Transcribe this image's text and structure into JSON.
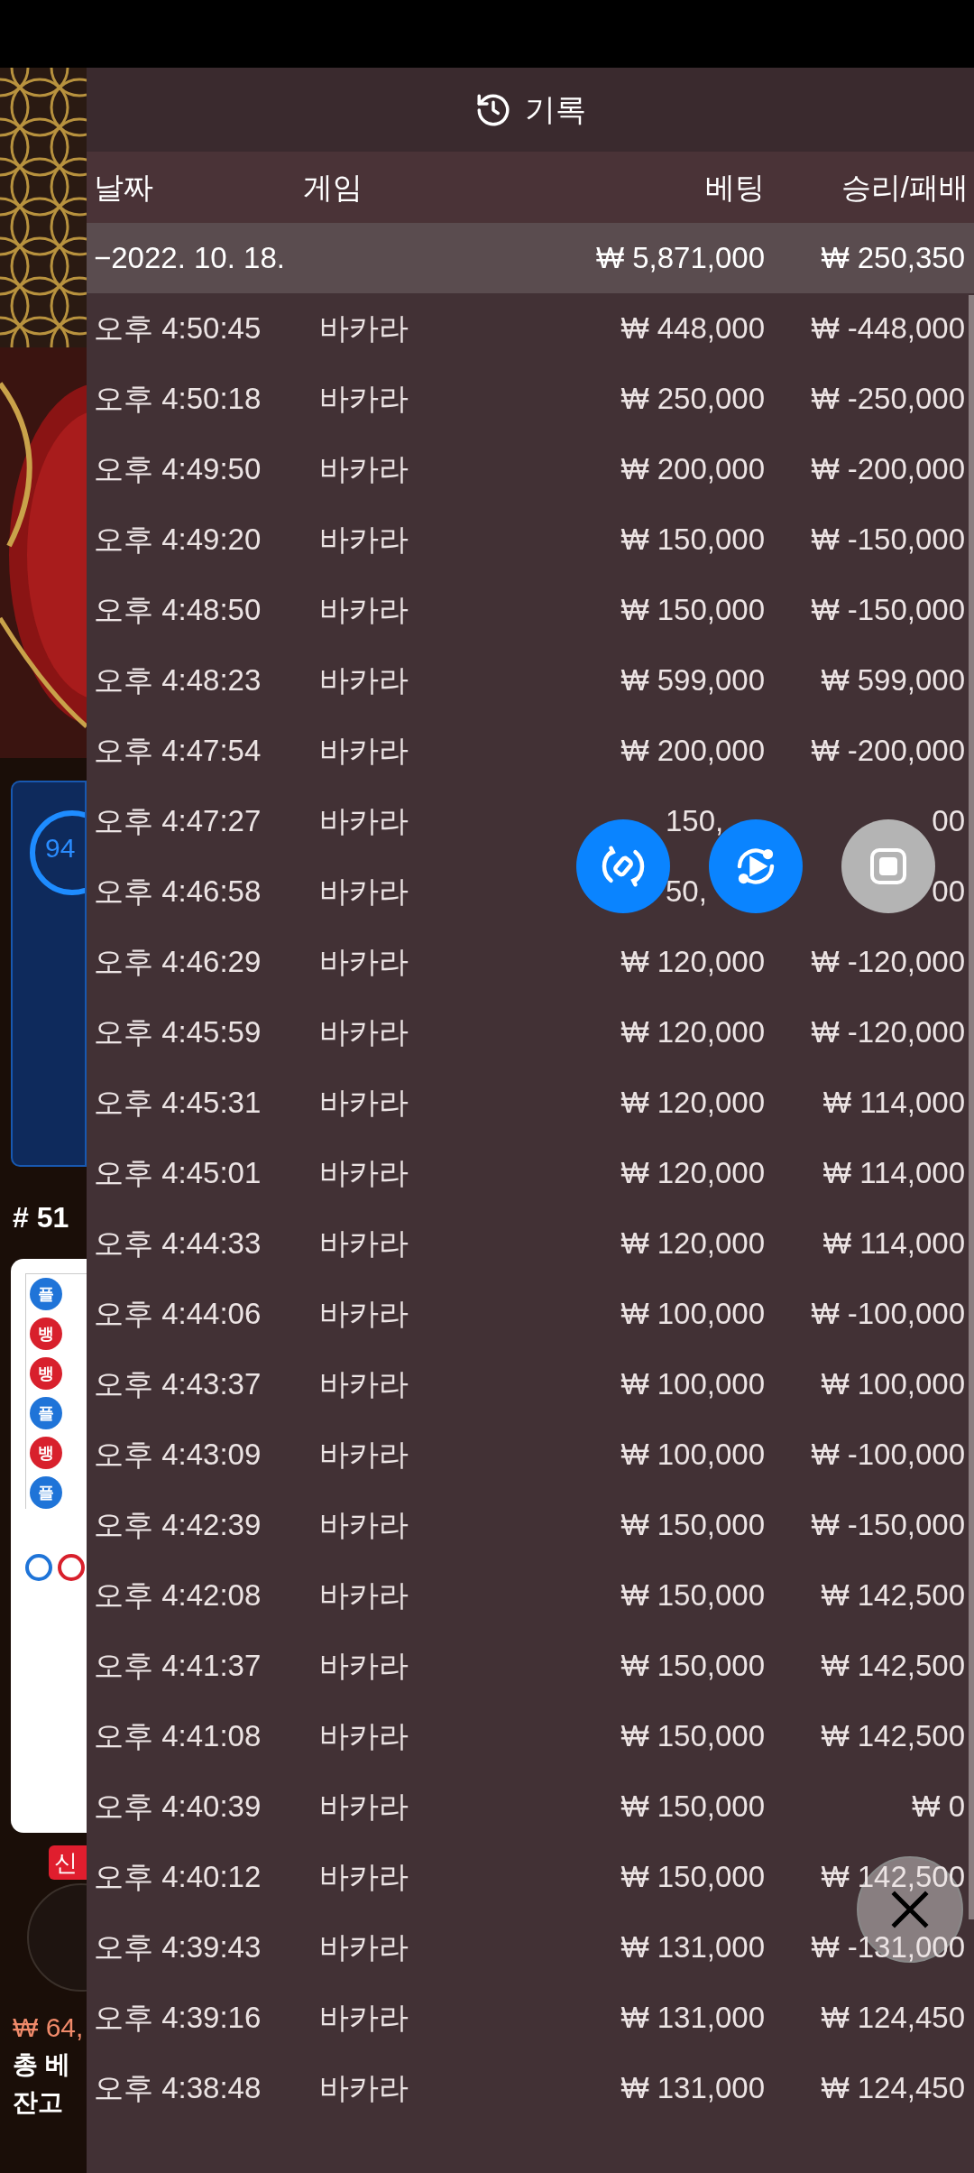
{
  "header": {
    "title": "기록"
  },
  "columns": [
    "날짜",
    "게임",
    "베팅",
    "승리/패배"
  ],
  "date_group": {
    "date": "−2022. 10. 18.",
    "bet": "₩ 5,871,000",
    "result": "₩ 250,350"
  },
  "rows": [
    {
      "kind": "plain",
      "time": "오후 4:50:45",
      "game": "바카라",
      "bet": "₩ 448,000",
      "result": "₩ -448,000"
    },
    {
      "kind": "plain",
      "time": "오후 4:50:18",
      "game": "바카라",
      "bet": "₩ 250,000",
      "result": "₩ -250,000"
    },
    {
      "kind": "plain",
      "time": "오후 4:49:50",
      "game": "바카라",
      "bet": "₩ 200,000",
      "result": "₩ -200,000"
    },
    {
      "kind": "plain",
      "time": "오후 4:49:20",
      "game": "바카라",
      "bet": "₩ 150,000",
      "result": "₩ -150,000"
    },
    {
      "kind": "plain",
      "time": "오후 4:48:50",
      "game": "바카라",
      "bet": "₩ 150,000",
      "result": "₩ -150,000"
    },
    {
      "kind": "plain",
      "time": "오후 4:48:23",
      "game": "바카라",
      "bet": "₩ 599,000",
      "result": "₩ 599,000"
    },
    {
      "kind": "plain",
      "time": "오후 4:47:54",
      "game": "바카라",
      "bet": "₩ 200,000",
      "result": "₩ -200,000"
    },
    {
      "kind": "covered",
      "time": "오후 4:47:27",
      "game": "바카라",
      "bet": "150,",
      "result": "00"
    },
    {
      "kind": "covered",
      "time": "오후 4:46:58",
      "game": "바카라",
      "bet": "50,",
      "result": "00"
    },
    {
      "kind": "plain",
      "time": "오후 4:46:29",
      "game": "바카라",
      "bet": "₩ 120,000",
      "result": "₩ -120,000"
    },
    {
      "kind": "plain",
      "time": "오후 4:45:59",
      "game": "바카라",
      "bet": "₩ 120,000",
      "result": "₩ -120,000"
    },
    {
      "kind": "plain",
      "time": "오후 4:45:31",
      "game": "바카라",
      "bet": "₩ 120,000",
      "result": "₩ 114,000"
    },
    {
      "kind": "plain",
      "time": "오후 4:45:01",
      "game": "바카라",
      "bet": "₩ 120,000",
      "result": "₩ 114,000"
    },
    {
      "kind": "plain",
      "time": "오후 4:44:33",
      "game": "바카라",
      "bet": "₩ 120,000",
      "result": "₩ 114,000"
    },
    {
      "kind": "plain",
      "time": "오후 4:44:06",
      "game": "바카라",
      "bet": "₩ 100,000",
      "result": "₩ -100,000"
    },
    {
      "kind": "plain",
      "time": "오후 4:43:37",
      "game": "바카라",
      "bet": "₩ 100,000",
      "result": "₩ 100,000"
    },
    {
      "kind": "plain",
      "time": "오후 4:43:09",
      "game": "바카라",
      "bet": "₩ 100,000",
      "result": "₩ -100,000"
    },
    {
      "kind": "plain",
      "time": "오후 4:42:39",
      "game": "바카라",
      "bet": "₩ 150,000",
      "result": "₩ -150,000"
    },
    {
      "kind": "plain",
      "time": "오후 4:42:08",
      "game": "바카라",
      "bet": "₩ 150,000",
      "result": "₩ 142,500"
    },
    {
      "kind": "plain",
      "time": "오후 4:41:37",
      "game": "바카라",
      "bet": "₩ 150,000",
      "result": "₩ 142,500"
    },
    {
      "kind": "plain",
      "time": "오후 4:41:08",
      "game": "바카라",
      "bet": "₩ 150,000",
      "result": "₩ 142,500"
    },
    {
      "kind": "plain",
      "time": "오후 4:40:39",
      "game": "바카라",
      "bet": "₩ 150,000",
      "result": "₩ 0"
    },
    {
      "kind": "plain",
      "time": "오후 4:40:12",
      "game": "바카라",
      "bet": "₩ 150,000",
      "result": "₩ 142,500"
    },
    {
      "kind": "plain",
      "time": "오후 4:39:43",
      "game": "바카라",
      "bet": "₩ 131,000",
      "result": "₩ -131,000"
    },
    {
      "kind": "plain",
      "time": "오후 4:39:16",
      "game": "바카라",
      "bet": "₩ 131,000",
      "result": "₩ 124,450"
    },
    {
      "kind": "plain",
      "time": "오후 4:38:48",
      "game": "바카라",
      "bet": "₩ 131,000",
      "result": "₩ 124,450"
    }
  ],
  "game_behind": {
    "progress": "94",
    "round": "# 51",
    "beads": [
      {
        "label": "플",
        "color": "#1f74d8"
      },
      {
        "label": "뱅",
        "color": "#d8202c"
      },
      {
        "label": "뱅",
        "color": "#d8202c"
      },
      {
        "label": "플",
        "color": "#1f74d8"
      },
      {
        "label": "뱅",
        "color": "#d8202c"
      },
      {
        "label": "플",
        "color": "#1f74d8"
      }
    ],
    "badge": "신",
    "win_amount": "₩ 64,",
    "total_bet": "총 베",
    "balance_label": "잔고"
  }
}
